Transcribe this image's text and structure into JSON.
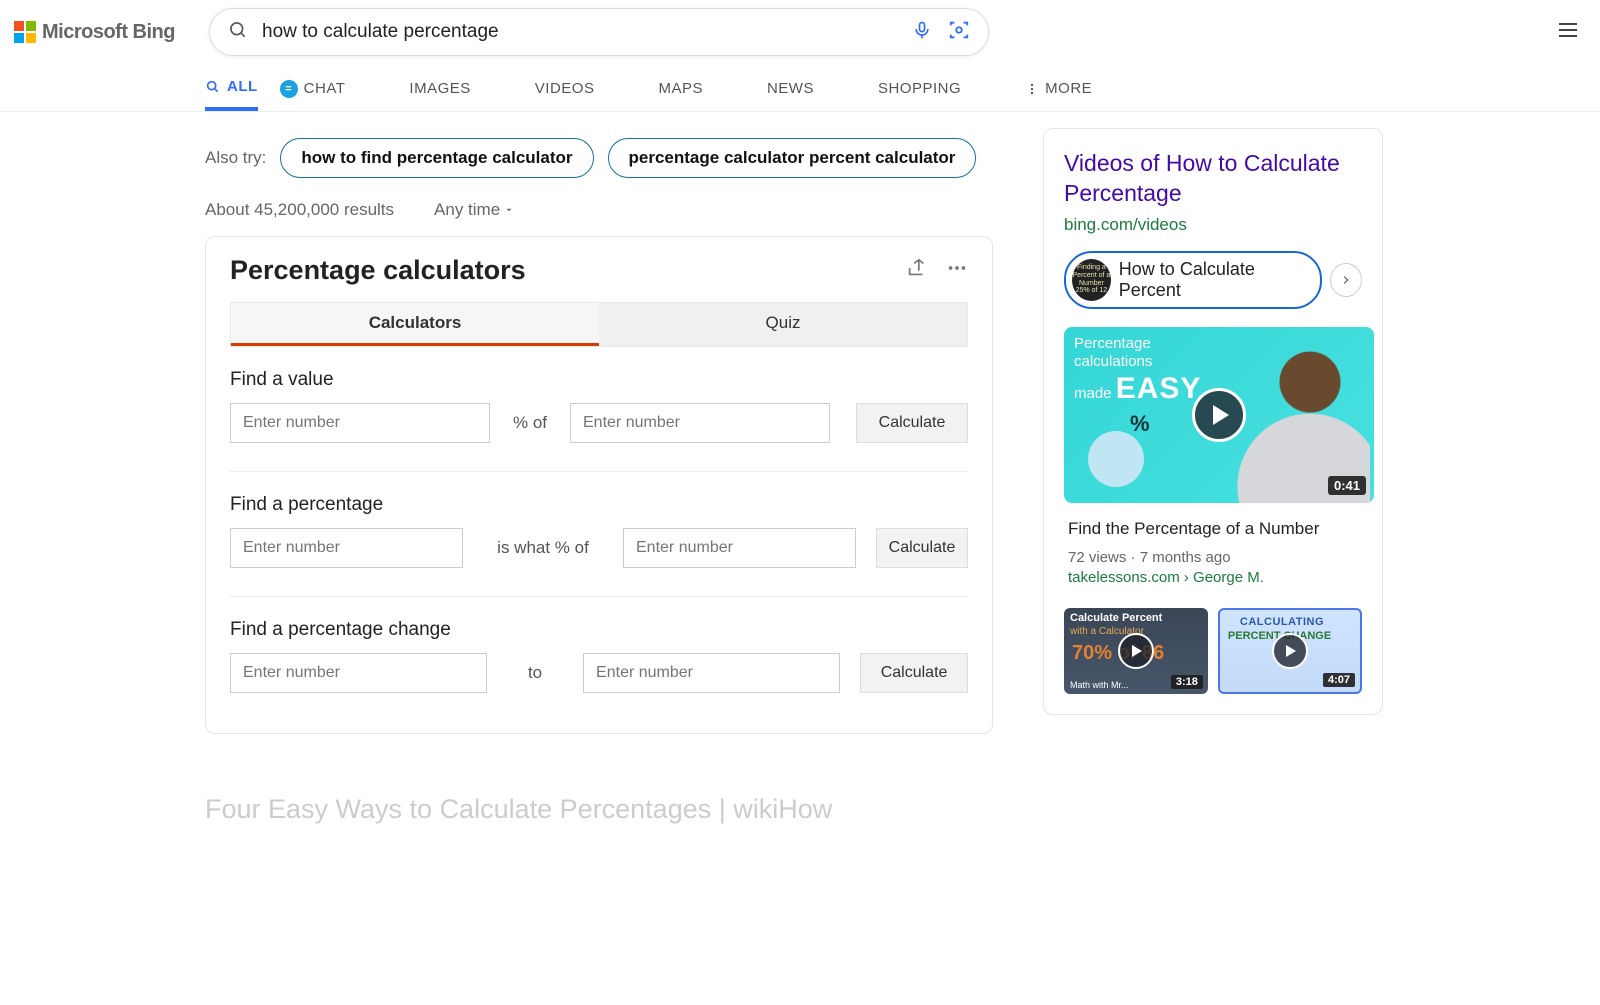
{
  "brand": {
    "name": "Microsoft Bing"
  },
  "search": {
    "query": "how to calculate percentage"
  },
  "nav": {
    "all": "ALL",
    "chat": "CHAT",
    "images": "IMAGES",
    "videos": "VIDEOS",
    "maps": "MAPS",
    "news": "NEWS",
    "shopping": "SHOPPING",
    "more": "MORE"
  },
  "also_try": {
    "label": "Also try:",
    "pills": [
      "how to find percentage calculator",
      "percentage calculator percent calculator"
    ]
  },
  "results_meta": {
    "count": "About 45,200,000 results",
    "time_filter": "Any time"
  },
  "card": {
    "title": "Percentage calculators",
    "tabs": {
      "calc": "Calculators",
      "quiz": "Quiz"
    },
    "calculate_label": "Calculate",
    "sections": {
      "find_value": {
        "title": "Find a value",
        "placeholder1": "Enter number",
        "op": "% of",
        "placeholder2": "Enter number"
      },
      "find_percentage": {
        "title": "Find a percentage",
        "placeholder1": "Enter number",
        "op": "is what % of",
        "placeholder2": "Enter number"
      },
      "find_change": {
        "title": "Find a percentage change",
        "placeholder1": "Enter number",
        "op": "to",
        "placeholder2": "Enter number"
      }
    }
  },
  "next_result_teaser": "Four Easy Ways to Calculate Percentages | wikiHow",
  "right": {
    "title": "Videos of How to Calculate Percentage",
    "source": "bing.com/videos",
    "chip_label": "How to Calculate Percent",
    "chip_thumb_lines": "Finding a\nPercent of\na Number\n25% of 12",
    "main_video": {
      "overlay_line1": "Percentage",
      "overlay_line2": "calculations",
      "overlay_line3_prefix": "made ",
      "overlay_line3_big": "EASY",
      "duration": "0:41",
      "title": "Find the Percentage of a Number",
      "meta": "72 views · 7 months ago",
      "source": "takelessons.com › George M."
    },
    "mini": [
      {
        "line1": "Calculate Percent",
        "line2": "with a Calculator",
        "big": "70% of 86",
        "bottom": "Math with Mr...",
        "duration": "3:18"
      },
      {
        "line1": "CALCULATING",
        "line2": "PERCENT    CHANGE",
        "duration": "4:07"
      }
    ]
  }
}
